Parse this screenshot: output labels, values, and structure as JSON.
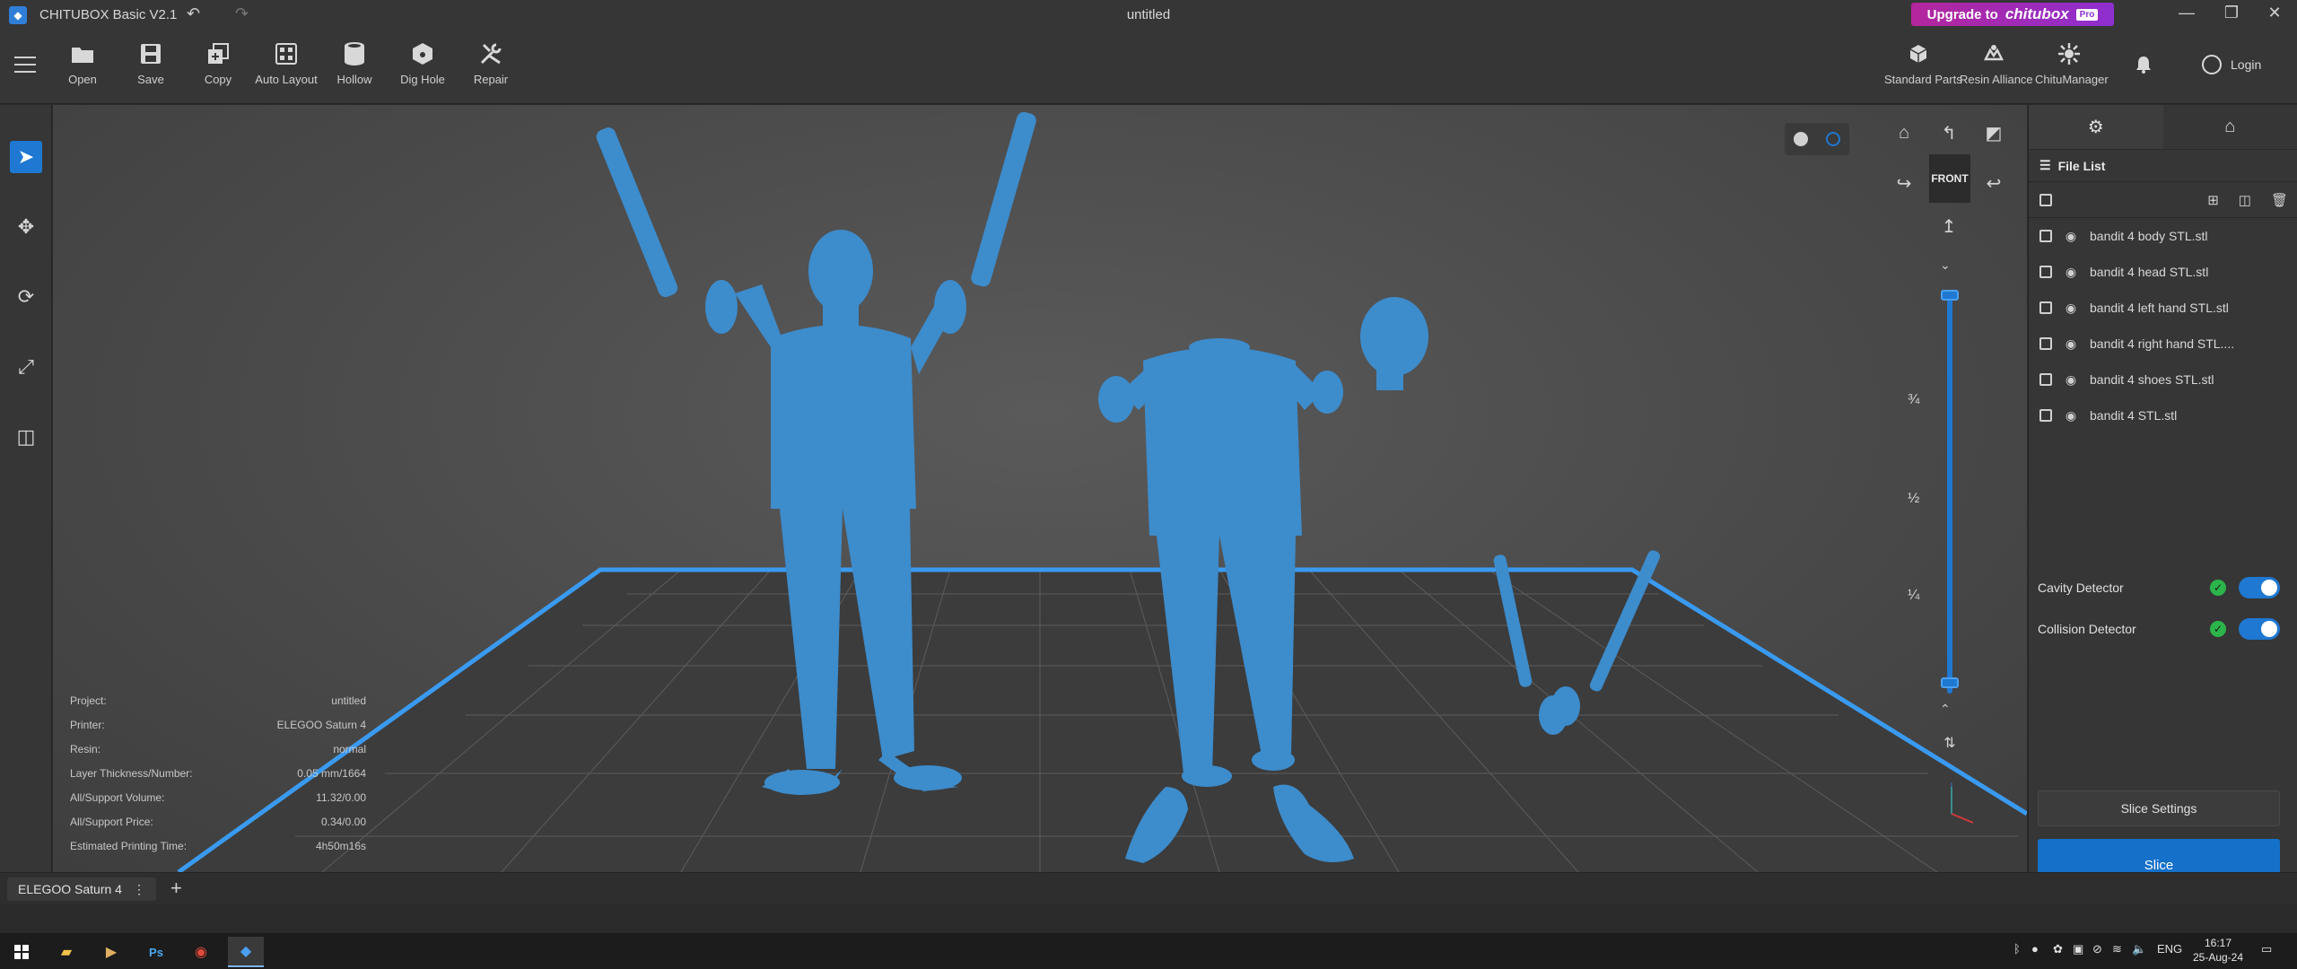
{
  "window": {
    "app_name": "CHITUBOX Basic V2.1",
    "doc_title": "untitled",
    "upgrade_label": "Upgrade to",
    "upgrade_brand": "chitubox",
    "upgrade_badge": "Pro"
  },
  "toolbar": {
    "tools": [
      {
        "label": "Open",
        "icon": "folder-icon"
      },
      {
        "label": "Save",
        "icon": "save-icon"
      },
      {
        "label": "Copy",
        "icon": "copy-icon"
      },
      {
        "label": "Auto Layout",
        "icon": "auto-layout-icon"
      },
      {
        "label": "Hollow",
        "icon": "hollow-icon"
      },
      {
        "label": "Dig Hole",
        "icon": "dig-hole-icon"
      },
      {
        "label": "Repair",
        "icon": "repair-icon"
      }
    ],
    "right_tools": [
      {
        "label": "Standard Parts",
        "icon": "standard-parts-icon"
      },
      {
        "label": "Resin Alliance",
        "icon": "resin-alliance-icon"
      },
      {
        "label": "ChituManager",
        "icon": "chitumanager-icon"
      }
    ],
    "login_label": "Login"
  },
  "viewport": {
    "view_label": "FRONT",
    "layer_fractions": [
      "¾",
      "½",
      "¼"
    ],
    "info": [
      {
        "label": "Project:",
        "value": "untitled"
      },
      {
        "label": "Printer:",
        "value": "ELEGOO Saturn 4"
      },
      {
        "label": "Resin:",
        "value": "normal"
      },
      {
        "label": "Layer Thickness/Number:",
        "value": "0.05 mm/1664"
      },
      {
        "label": "All/Support Volume:",
        "value": "11.32/0.00"
      },
      {
        "label": "All/Support Price:",
        "value": "0.34/0.00"
      },
      {
        "label": "Estimated Printing Time:",
        "value": "4h50m16s"
      }
    ]
  },
  "filelist": {
    "title": "File List",
    "files": [
      "bandit 4 body STL.stl",
      "bandit 4 head STL.stl",
      "bandit 4 left hand STL.stl",
      "bandit 4 right hand STL....",
      "bandit 4 shoes STL.stl",
      "bandit 4 STL.stl"
    ]
  },
  "detectors": [
    {
      "label": "Cavity Detector",
      "enabled": true
    },
    {
      "label": "Collision Detector",
      "enabled": true
    }
  ],
  "actions": {
    "slice_settings": "Slice Settings",
    "slice": "Slice"
  },
  "printer_tab": {
    "name": "ELEGOO Saturn 4",
    "add": "+"
  },
  "taskbar": {
    "lang": "ENG",
    "time": "16:17",
    "date": "25-Aug-24"
  },
  "colors": {
    "accent": "#1f78d1",
    "model": "#3d8ccc",
    "upgrade": "#a52aba"
  }
}
